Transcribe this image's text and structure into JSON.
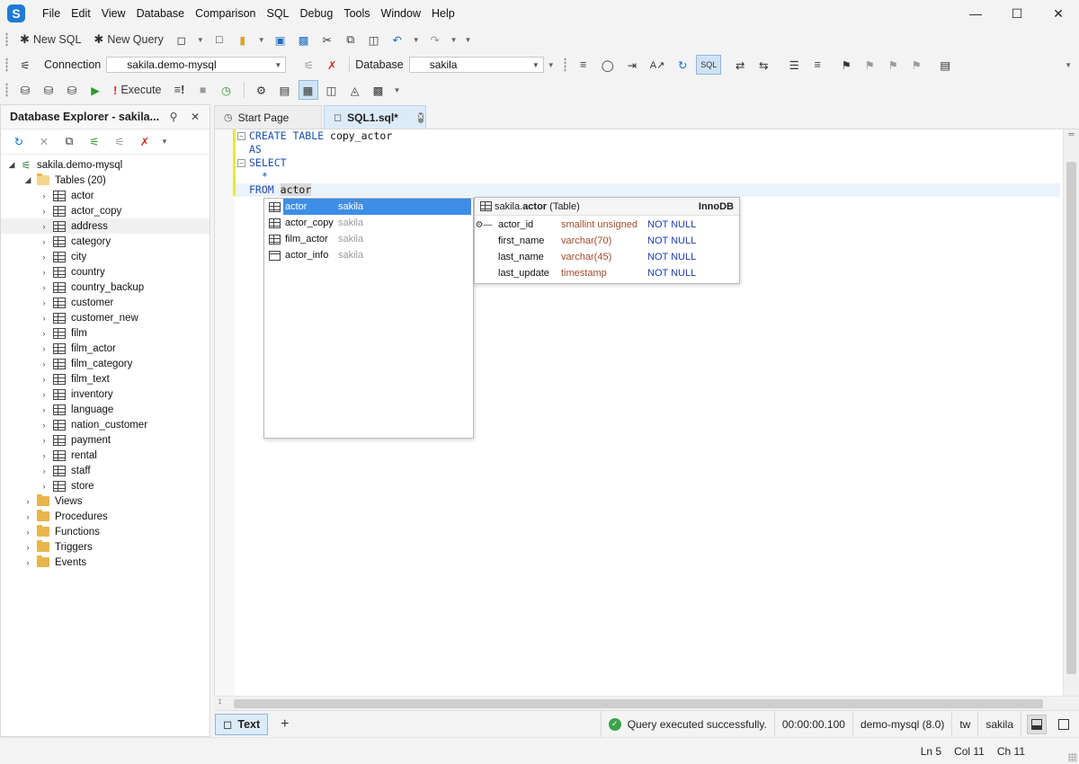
{
  "menu": [
    "File",
    "Edit",
    "View",
    "Database",
    "Comparison",
    "SQL",
    "Debug",
    "Tools",
    "Window",
    "Help"
  ],
  "app_logo": "S",
  "toolbar1": {
    "new_sql": "New SQL",
    "new_query": "New Query"
  },
  "toolbar2": {
    "connection_label": "Connection",
    "connection_value": "sakila.demo-mysql",
    "database_label": "Database",
    "database_value": "sakila",
    "sql_btn": "SQL"
  },
  "toolbar3": {
    "execute": "Execute"
  },
  "explorer": {
    "title": "Database Explorer - sakila...",
    "connection": "sakila.demo-mysql",
    "tables_folder": "Tables (20)",
    "tables": [
      "actor",
      "actor_copy",
      "address",
      "category",
      "city",
      "country",
      "country_backup",
      "customer",
      "customer_new",
      "film",
      "film_actor",
      "film_category",
      "film_text",
      "inventory",
      "language",
      "nation_customer",
      "payment",
      "rental",
      "staff",
      "store"
    ],
    "folders": [
      "Views",
      "Procedures",
      "Functions",
      "Triggers",
      "Events"
    ]
  },
  "tabs": {
    "start_page": "Start Page",
    "sql1": "SQL1.sql*"
  },
  "editor": {
    "kw_create_table": "CREATE TABLE",
    "table_name": " copy_actor",
    "kw_as": "AS",
    "kw_select": "SELECT",
    "star": "  *",
    "kw_from": "FROM",
    "from_word": "actor"
  },
  "autocomplete": {
    "items": [
      {
        "name": "actor",
        "schema": "sakila"
      },
      {
        "name": "actor_copy",
        "schema": "sakila"
      },
      {
        "name": "film_actor",
        "schema": "sakila"
      },
      {
        "name": "actor_info",
        "schema": "sakila"
      }
    ],
    "detail": {
      "prefix": "sakila.",
      "name": "actor",
      "kind": " (Table)",
      "engine": "InnoDB",
      "columns": [
        {
          "name": "actor_id",
          "type": "smallint unsigned",
          "null": "NOT NULL",
          "key": true
        },
        {
          "name": "first_name",
          "type": "varchar(70)",
          "null": "NOT NULL",
          "key": false
        },
        {
          "name": "last_name",
          "type": "varchar(45)",
          "null": "NOT NULL",
          "key": false
        },
        {
          "name": "last_update",
          "type": "timestamp",
          "null": "NOT NULL",
          "key": false
        }
      ]
    }
  },
  "bottombar": {
    "text_btn": "Text",
    "status_msg": "Query executed successfully.",
    "elapsed": "00:00:00.100",
    "server": "demo-mysql (8.0)",
    "user": "tw",
    "db": "sakila"
  },
  "appstatus": {
    "ln": "Ln 5",
    "col": "Col 11",
    "ch": "Ch 11"
  }
}
